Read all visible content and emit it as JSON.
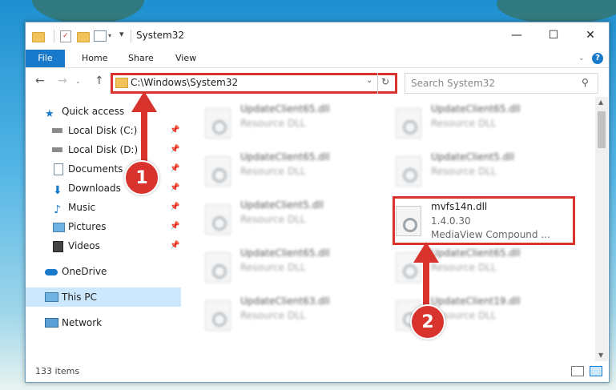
{
  "window": {
    "title": "System32"
  },
  "titlebar": {
    "minimize": "—",
    "maximize": "☐",
    "close": "✕"
  },
  "ribbon": {
    "file": "File",
    "home": "Home",
    "share": "Share",
    "view": "View",
    "help": "?"
  },
  "address": {
    "path": "C:\\Windows\\System32"
  },
  "search": {
    "placeholder": "Search System32"
  },
  "sidebar": {
    "items": [
      {
        "label": "Quick access"
      },
      {
        "label": "Local Disk (C:)"
      },
      {
        "label": "Local Disk (D:)"
      },
      {
        "label": "Documents"
      },
      {
        "label": "Downloads"
      },
      {
        "label": "Music"
      },
      {
        "label": "Pictures"
      },
      {
        "label": "Videos"
      },
      {
        "label": "OneDrive"
      },
      {
        "label": "This PC"
      },
      {
        "label": "Network"
      }
    ]
  },
  "files": [
    {
      "name": "UpdateClient65.dll",
      "type": "Resource DLL"
    },
    {
      "name": "UpdateClient65.dll",
      "type": "Resource DLL"
    },
    {
      "name": "UpdateClient65.dll",
      "type": "Resource DLL"
    },
    {
      "name": "UpdateClient5.dll",
      "type": "Resource DLL"
    },
    {
      "name": "UpdateClient5.dll",
      "type": "Resource DLL"
    },
    {
      "name": "mvfs14n.dll",
      "version": "1.4.0.30",
      "type": "MediaView Compound ..."
    },
    {
      "name": "UpdateClient65.dll",
      "type": "Resource DLL"
    },
    {
      "name": "UpdateClient65.dll",
      "type": "Resource DLL"
    },
    {
      "name": "UpdateClient63.dll",
      "type": "Resource DLL"
    },
    {
      "name": "UpdateClient19.dll",
      "type": "Resource DLL"
    }
  ],
  "status": {
    "count": "133 items"
  },
  "callouts": {
    "one": "1",
    "two": "2"
  },
  "colors": {
    "accent": "#1979ca",
    "callout": "#d8332c"
  }
}
